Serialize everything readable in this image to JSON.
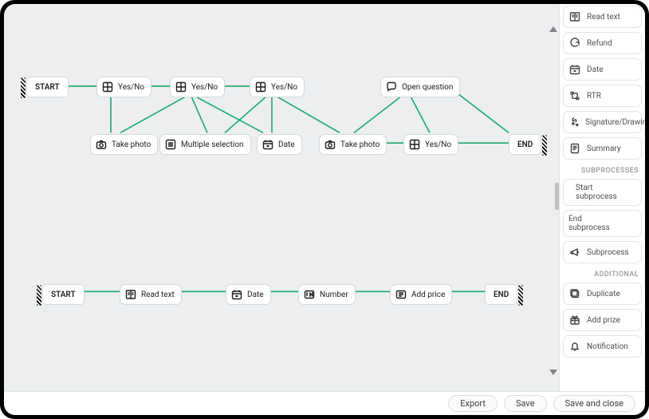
{
  "canvas": {
    "flow1": {
      "start": "START",
      "end": "END",
      "nodes": {
        "yesno1": {
          "label": "Yes/No",
          "icon": "grid"
        },
        "yesno2": {
          "label": "Yes/No",
          "icon": "grid"
        },
        "yesno3": {
          "label": "Yes/No",
          "icon": "grid"
        },
        "openq": {
          "label": "Open question",
          "icon": "chat"
        },
        "photo1": {
          "label": "Take photo",
          "icon": "camera"
        },
        "multi": {
          "label": "Multiple selection",
          "icon": "list"
        },
        "date": {
          "label": "Date",
          "icon": "calendar"
        },
        "photo2": {
          "label": "Take photo",
          "icon": "camera"
        },
        "yesno4": {
          "label": "Yes/No",
          "icon": "grid"
        }
      }
    },
    "flow2": {
      "start": "START",
      "end": "END",
      "nodes": {
        "readtext": {
          "label": "Read text",
          "icon": "book"
        },
        "date": {
          "label": "Date",
          "icon": "calendar"
        },
        "number": {
          "label": "Number",
          "icon": "number"
        },
        "addprice": {
          "label": "Add price",
          "icon": "price"
        }
      }
    }
  },
  "sidebar": {
    "items": [
      {
        "key": "readtext",
        "label": "Read text",
        "icon": "book"
      },
      {
        "key": "refund",
        "label": "Refund",
        "icon": "refund"
      },
      {
        "key": "date",
        "label": "Date",
        "icon": "calendar"
      },
      {
        "key": "rtr",
        "label": "RTR",
        "icon": "rtr"
      },
      {
        "key": "signature",
        "label": "Signature/Drawing",
        "icon": "signature"
      },
      {
        "key": "summary",
        "label": "Summary",
        "icon": "summary"
      }
    ],
    "heading1": "SUBPROCESSES",
    "sub": [
      {
        "key": "startsub",
        "label": "Start",
        "label2": "subprocess"
      },
      {
        "key": "endsub",
        "label": "End",
        "label2": "subprocess"
      },
      {
        "key": "subprocess",
        "label": "Subprocess",
        "icon": "announce"
      }
    ],
    "heading2": "ADDITIONAL",
    "additional": [
      {
        "key": "duplicate",
        "label": "Duplicate",
        "icon": "duplicate"
      },
      {
        "key": "addprize",
        "label": "Add prize",
        "icon": "gift"
      },
      {
        "key": "notification",
        "label": "Notification",
        "icon": "bell"
      }
    ]
  },
  "footer": {
    "export": "Export",
    "save": "Save",
    "saveclose": "Save and close"
  }
}
